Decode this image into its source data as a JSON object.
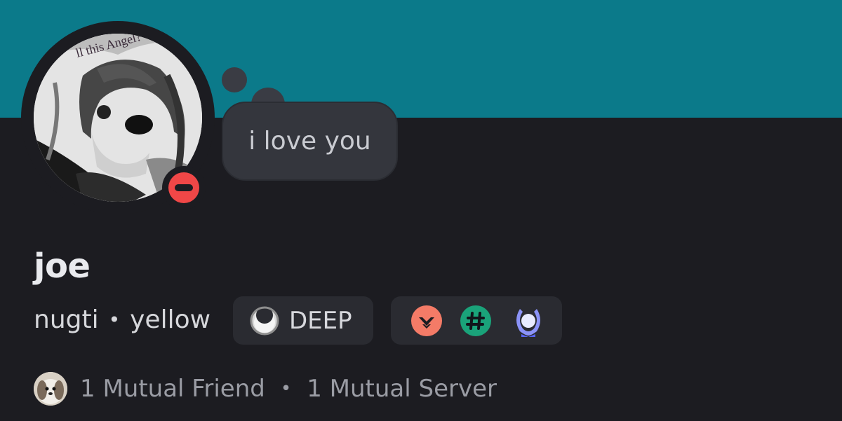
{
  "profile": {
    "custom_status": "i love you",
    "display_name": "joe",
    "username": "nugti",
    "separator": "•",
    "pronouns": "yellow",
    "clan_tag": "DEEP",
    "status": "do-not-disturb"
  },
  "avatar_overlay_text": "ll this Angel?",
  "badges": [
    {
      "icon": "hypesquad-bravery-icon",
      "color": "#f47b67"
    },
    {
      "icon": "hashtag-icon",
      "color": "#1aa37a"
    },
    {
      "icon": "laurel-icon",
      "color": "#8b93f8"
    }
  ],
  "mutuals": {
    "friends": "1 Mutual Friend",
    "separator": "•",
    "servers": "1 Mutual Server"
  },
  "colors": {
    "banner": "#0b7a8a",
    "background": "#1c1c21",
    "dnd": "#f04747",
    "pill": "#2a2b31"
  }
}
